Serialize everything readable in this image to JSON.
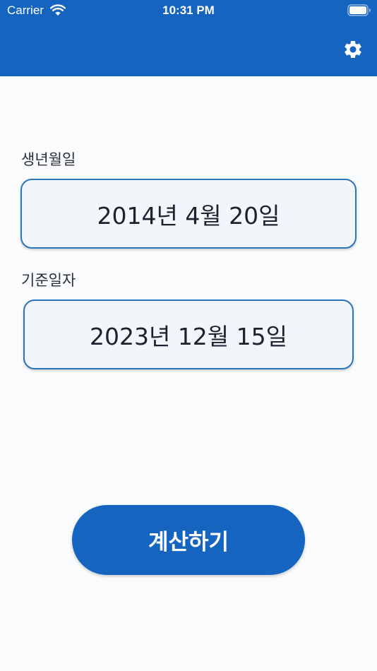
{
  "status_bar": {
    "carrier": "Carrier",
    "time": "10:31 PM",
    "wifi_icon": "wifi-icon",
    "battery_icon": "battery-full-icon"
  },
  "app_bar": {
    "background_color": "#1565c0",
    "settings_icon": "gear-icon"
  },
  "form": {
    "birth_date": {
      "label": "생년월일",
      "value": "2014년 4월 20일"
    },
    "reference_date": {
      "label": "기준일자",
      "value": "2023년 12월 15일"
    }
  },
  "actions": {
    "calculate_label": "계산하기"
  },
  "colors": {
    "accent": "#1565c0",
    "field_border": "#2a74c0",
    "field_background": "#f2f6fa",
    "page_background": "#f9fbfd"
  }
}
